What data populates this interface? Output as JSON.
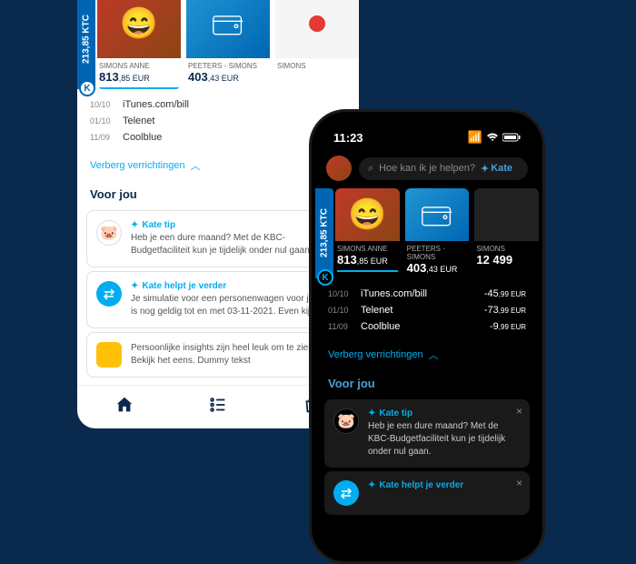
{
  "status": {
    "time": "11:23"
  },
  "search": {
    "placeholder": "Hoe kan ik je helpen?",
    "brand": "Kate"
  },
  "ktc": "213,85 KTC",
  "cards": [
    {
      "label": "SIMONS ANNE",
      "amount": "813",
      "cents": ",85 EUR",
      "type": "photo"
    },
    {
      "label": "PEETERS - SIMONS",
      "amount": "403",
      "cents": ",43 EUR",
      "type": "wallet"
    },
    {
      "label": "SIMONS",
      "amount": "12 499",
      "cents": "",
      "type": "other"
    }
  ],
  "transactions": [
    {
      "date": "10/10",
      "name": "iTunes.com/bill",
      "amount": "-45",
      "cents": ",99 EUR"
    },
    {
      "date": "01/10",
      "name": "Telenet",
      "amount": "-73",
      "cents": ",99 EUR"
    },
    {
      "date": "11/09",
      "name": "Coolblue",
      "amount": "-9",
      "cents": ",99 EUR"
    }
  ],
  "toggle": "Verberg verrichtingen",
  "section": "Voor jou",
  "tips": [
    {
      "title": "Kate tip",
      "text": "Heb je een dure maand? Met de KBC-Budgetfaciliteit kun je tijdelijk onder nul gaan."
    },
    {
      "title": "Kate helpt je verder",
      "text": "Je simulatie voor een personenwagen voor je zaak is nog geldig tot en met 03-11-2021. Even kijken?"
    },
    {
      "title": "",
      "text": "Persoonlijke insights zijn heel leuk om te zien. Bekijk het eens. Dummy tekst"
    }
  ],
  "light_tips": [
    {
      "title": "Kate tip",
      "text": "Heb je een dure maand? Met de KBC-Budgetfaciliteit kun je tijdelijk onder nul gaan."
    },
    {
      "title": "Kate helpt je verder",
      "text": "Je simulatie voor een personenwagen voor je zaak is nog geldig tot en met 03-11-2021. Even kijken?"
    }
  ]
}
